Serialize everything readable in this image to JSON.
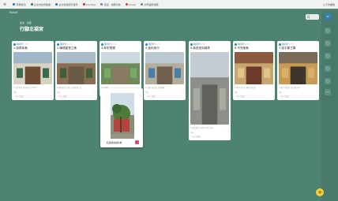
{
  "topbar": {
    "menu_icon": "menu-icon",
    "bookmarks": [
      {
        "label": "苹果新闻",
        "color": "#2f7fb8"
      },
      {
        "label": "台北市政府数据",
        "color": "#3d8b5a"
      },
      {
        "label": "台北市政府影音库",
        "color": "#2f7fb8"
      },
      {
        "label": "YouTube",
        "color": "#e0322d"
      },
      {
        "label": "街道 · 地圖行動",
        "color": "#6a8fb3"
      },
      {
        "label": "Gmail",
        "color": "#d54a3c"
      },
      {
        "label": "文學國家地圖",
        "color": "#888888"
      }
    ],
    "right_label": "以下的書籤"
  },
  "header": {
    "brand": "Padlet"
  },
  "board": {
    "subtitle": "臺北 · 街巷",
    "title": "行腳北福宮"
  },
  "search": {
    "label": "Q"
  },
  "columns": [
    {
      "author": "陳同學",
      "count": "1 / 3",
      "title": "1.街角街巷",
      "tag": "1.街區巷弄 老宅街道 方的門",
      "time": "3天",
      "icon": "▢",
      "fav": "☆ 加入收藏"
    },
    {
      "author": "陳同學",
      "count": "2 / 3",
      "title": "2.陳德星堂之美",
      "tag": "2.陳德星堂 仕紳 古老建築之美",
      "time": "3天",
      "icon": "▢",
      "fav": "☆ 加入收藏"
    },
    {
      "author": "陳同學",
      "count": "3 / 3",
      "title": "3.林宅再現",
      "tag": "3.大宅院",
      "time": "3天",
      "icon": "▢",
      "fav": ""
    },
    {
      "author": "陳同學",
      "count": "4 / 3",
      "title": "4.迪化街行",
      "tag": "4.街屋 迪化街 古厝建築",
      "time": "3天",
      "icon": "▢",
      "fav": "☆ 加入收藏"
    },
    {
      "author": "陳同學",
      "count": "5 / 3",
      "title": "5.新莊老街巷弄",
      "tag": "5.老街巷弄 走過的小巷 街角",
      "time": "3天",
      "icon": "▢",
      "fav": "☆ 加入收藏"
    },
    {
      "author": "陳同學",
      "count": "6 / 3",
      "title": "6.不完美巷",
      "tag": "6.巷弄 老房子 磚紅色的牆",
      "time": "3天",
      "icon": "▢",
      "fav": "☆ 加入收藏"
    },
    {
      "author": "陳同學",
      "count": "7 / 3",
      "title": "7.延平郡王廟",
      "tag": "7.廟宇 老街區 延平郡王祠",
      "time": "3天",
      "icon": "▢",
      "fav": "☆ 加入收藏"
    }
  ],
  "floating_card": {
    "label": "紅牆與綠樹共舞"
  },
  "rail": [
    "≡",
    "▢",
    "▢",
    "▢",
    "▢",
    "▢",
    "—"
  ],
  "fab": "+"
}
